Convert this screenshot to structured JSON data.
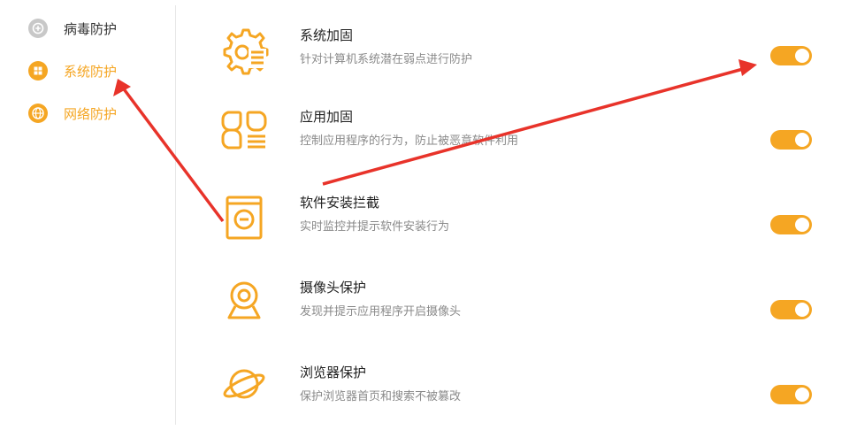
{
  "sidebar": {
    "items": [
      {
        "label": "病毒防护",
        "icon": "plus-circle-icon",
        "active": false
      },
      {
        "label": "系统防护",
        "icon": "windows-icon",
        "active": true
      },
      {
        "label": "网络防护",
        "icon": "globe-icon",
        "active": false
      }
    ]
  },
  "protections": [
    {
      "title": "系统加固",
      "desc": "针对计算机系统潜在弱点进行防护",
      "icon": "gear-shield-icon",
      "enabled": true
    },
    {
      "title": "应用加固",
      "desc": "控制应用程序的行为，防止被恶意软件利用",
      "icon": "apps-icon",
      "enabled": true
    },
    {
      "title": "软件安装拦截",
      "desc": "实时监控并提示软件安装行为",
      "icon": "install-block-icon",
      "enabled": true
    },
    {
      "title": "摄像头保护",
      "desc": "发现并提示应用程序开启摄像头",
      "icon": "webcam-icon",
      "enabled": true
    },
    {
      "title": "浏览器保护",
      "desc": "保护浏览器首页和搜索不被篡改",
      "icon": "planet-icon",
      "enabled": true
    }
  ],
  "colors": {
    "accent": "#f5a623",
    "annotation_arrow": "#e8332a",
    "inactive_icon": "#c8c8c8"
  }
}
